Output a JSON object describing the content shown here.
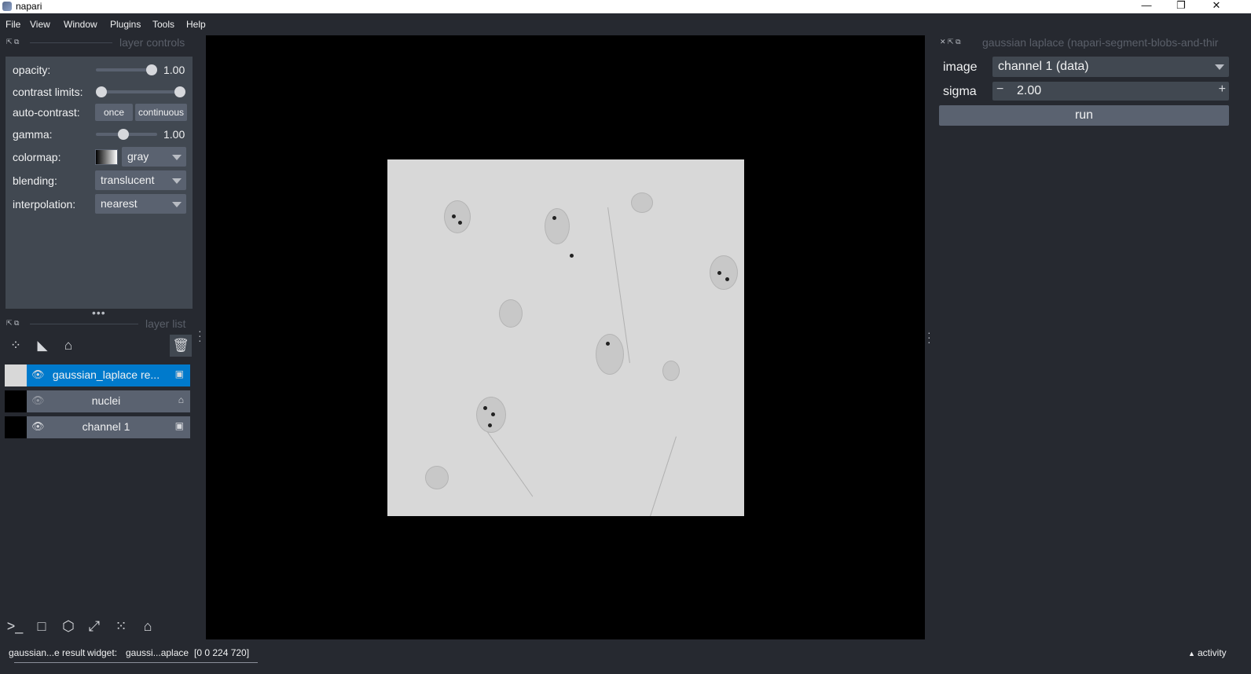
{
  "window": {
    "title": "napari",
    "controls": {
      "minimize": "—",
      "maximize": "❐",
      "close": "✕"
    }
  },
  "menu": [
    "File",
    "View",
    "Window",
    "Plugins",
    "Tools",
    "Help"
  ],
  "layer_controls": {
    "title": "layer controls",
    "opacity_label": "opacity:",
    "opacity_value": "1.00",
    "opacity_level": 1.0,
    "contrast_label": "contrast limits:",
    "autocontrast_label": "auto-contrast:",
    "once_label": "once",
    "continuous_label": "continuous",
    "gamma_label": "gamma:",
    "gamma_value": "1.00",
    "colormap_label": "colormap:",
    "colormap_value": "gray",
    "blending_label": "blending:",
    "blending_value": "translucent",
    "interpolation_label": "interpolation:",
    "interpolation_value": "nearest"
  },
  "layer_list": {
    "title": "layer list",
    "layers": [
      {
        "name": "gaussian_laplace re...",
        "visible": true,
        "type_icon": "image-icon",
        "selected": true
      },
      {
        "name": "nuclei",
        "visible": false,
        "type_icon": "labels-icon",
        "selected": false
      },
      {
        "name": "channel 1",
        "visible": true,
        "type_icon": "image-icon",
        "selected": false
      }
    ]
  },
  "widget": {
    "title": "gaussian laplace (napari-segment-blobs-and-thir",
    "image_label": "image",
    "image_value": "channel 1 (data)",
    "sigma_label": "sigma",
    "sigma_value": "2.00",
    "sigma_minus": "−",
    "sigma_plus": "+",
    "run_label": "run"
  },
  "statusbar": {
    "layer": "gaussian...e result",
    "widget_label": "widget:",
    "widget_value": "gaussi...aplace",
    "coords": "[0 0 224 720]",
    "activity": "activity"
  },
  "colors": {
    "background": "#262930",
    "panel": "#414851",
    "control": "#5a6270",
    "selected": "#007acc"
  }
}
